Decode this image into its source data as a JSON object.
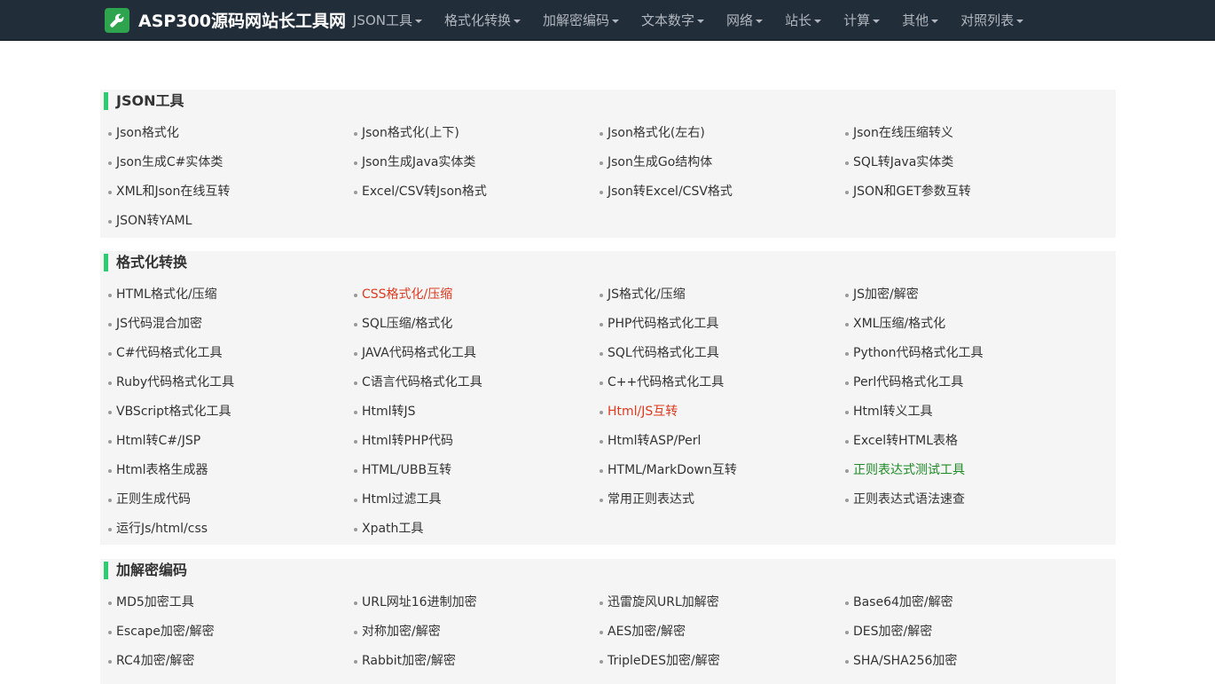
{
  "brand": {
    "title": "ASP300源码网站长工具网"
  },
  "nav": [
    {
      "label": "JSON工具"
    },
    {
      "label": "格式化转换"
    },
    {
      "label": "加解密编码"
    },
    {
      "label": "文本数字"
    },
    {
      "label": "网络"
    },
    {
      "label": "站长"
    },
    {
      "label": "计算"
    },
    {
      "label": "其他"
    },
    {
      "label": "对照列表"
    }
  ],
  "sections": [
    {
      "title": "JSON工具",
      "items": [
        {
          "label": "Json格式化"
        },
        {
          "label": " Json格式化(上下)"
        },
        {
          "label": "Json格式化(左右)"
        },
        {
          "label": "Json在线压缩转义"
        },
        {
          "label": "Json生成C#实体类"
        },
        {
          "label": " Json生成Java实体类"
        },
        {
          "label": "Json生成Go结构体"
        },
        {
          "label": "SQL转Java实体类"
        },
        {
          "label": "XML和Json在线互转"
        },
        {
          "label": "Excel/CSV转Json格式"
        },
        {
          "label": "Json转Excel/CSV格式"
        },
        {
          "label": "JSON和GET参数互转"
        },
        {
          "label": "JSON转YAML"
        }
      ]
    },
    {
      "title": "格式化转换",
      "items": [
        {
          "label": "HTML格式化/压缩"
        },
        {
          "label": " CSS格式化/压缩",
          "color": "#dd3a1f"
        },
        {
          "label": "JS格式化/压缩"
        },
        {
          "label": "JS加密/解密"
        },
        {
          "label": " JS代码混合加密"
        },
        {
          "label": "SQL压缩/格式化"
        },
        {
          "label": "PHP代码格式化工具"
        },
        {
          "label": "XML压缩/格式化"
        },
        {
          "label": "C#代码格式化工具"
        },
        {
          "label": "JAVA代码格式化工具"
        },
        {
          "label": "SQL代码格式化工具"
        },
        {
          "label": "Python代码格式化工具"
        },
        {
          "label": "Ruby代码格式化工具"
        },
        {
          "label": "C语言代码格式化工具"
        },
        {
          "label": "C++代码格式化工具"
        },
        {
          "label": "Perl代码格式化工具"
        },
        {
          "label": "VBScript格式化工具"
        },
        {
          "label": " Html转JS"
        },
        {
          "label": "Html/JS互转",
          "color": "#dd3a1f"
        },
        {
          "label": " Html转义工具"
        },
        {
          "label": " Html转C#/JSP"
        },
        {
          "label": "Html转PHP代码"
        },
        {
          "label": "Html转ASP/Perl"
        },
        {
          "label": "Excel转HTML表格"
        },
        {
          "label": "Html表格生成器"
        },
        {
          "label": "HTML/UBB互转"
        },
        {
          "label": "HTML/MarkDown互转"
        },
        {
          "label": "正则表达式测试工具",
          "color": "#1e8a28"
        },
        {
          "label": "正则生成代码"
        },
        {
          "label": "Html过滤工具"
        },
        {
          "label": "常用正则表达式"
        },
        {
          "label": "正则表达式语法速查"
        },
        {
          "label": "运行Js/html/css"
        },
        {
          "label": "Xpath工具"
        }
      ]
    },
    {
      "title": "加解密编码",
      "items": [
        {
          "label": "MD5加密工具"
        },
        {
          "label": "URL网址16进制加密"
        },
        {
          "label": "迅雷旋风URL加解密"
        },
        {
          "label": " Base64加密/解密"
        },
        {
          "label": "Escape加密/解密"
        },
        {
          "label": "对称加密/解密"
        },
        {
          "label": "AES加密/解密"
        },
        {
          "label": "DES加密/解密"
        },
        {
          "label": "RC4加密/解密"
        },
        {
          "label": "Rabbit加密/解密"
        },
        {
          "label": "TripleDES加密/解密"
        },
        {
          "label": "SHA/SHA256加密"
        }
      ]
    }
  ]
}
